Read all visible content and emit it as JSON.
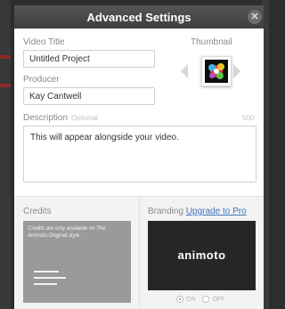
{
  "dialog": {
    "title": "Advanced Settings",
    "close_glyph": "✕"
  },
  "form": {
    "video_title_label": "Video Title",
    "video_title_value": "Untitled Project",
    "producer_label": "Producer",
    "producer_value": "Kay Cantwell",
    "description_label": "Description",
    "description_optional": "Optional",
    "description_counter": "500",
    "description_value": "This will appear alongside your video."
  },
  "thumbnail": {
    "label": "Thumbnail"
  },
  "credits": {
    "label": "Credits",
    "note": "Credits are only available on The Animoto Original style."
  },
  "branding": {
    "label": "Branding",
    "upgrade_link": "Upgrade to Pro",
    "logo_text": "animoto",
    "on_label": "ON",
    "off_label": "OFF",
    "selected": "on"
  },
  "colors": {
    "titlebar": "#4a4a4a",
    "link": "#3b73b9",
    "credits_bg": "#9a9a9a",
    "branding_bg": "#262626"
  },
  "icons": {
    "close": "close-icon",
    "prev": "chevron-left-icon",
    "next": "chevron-right-icon"
  }
}
